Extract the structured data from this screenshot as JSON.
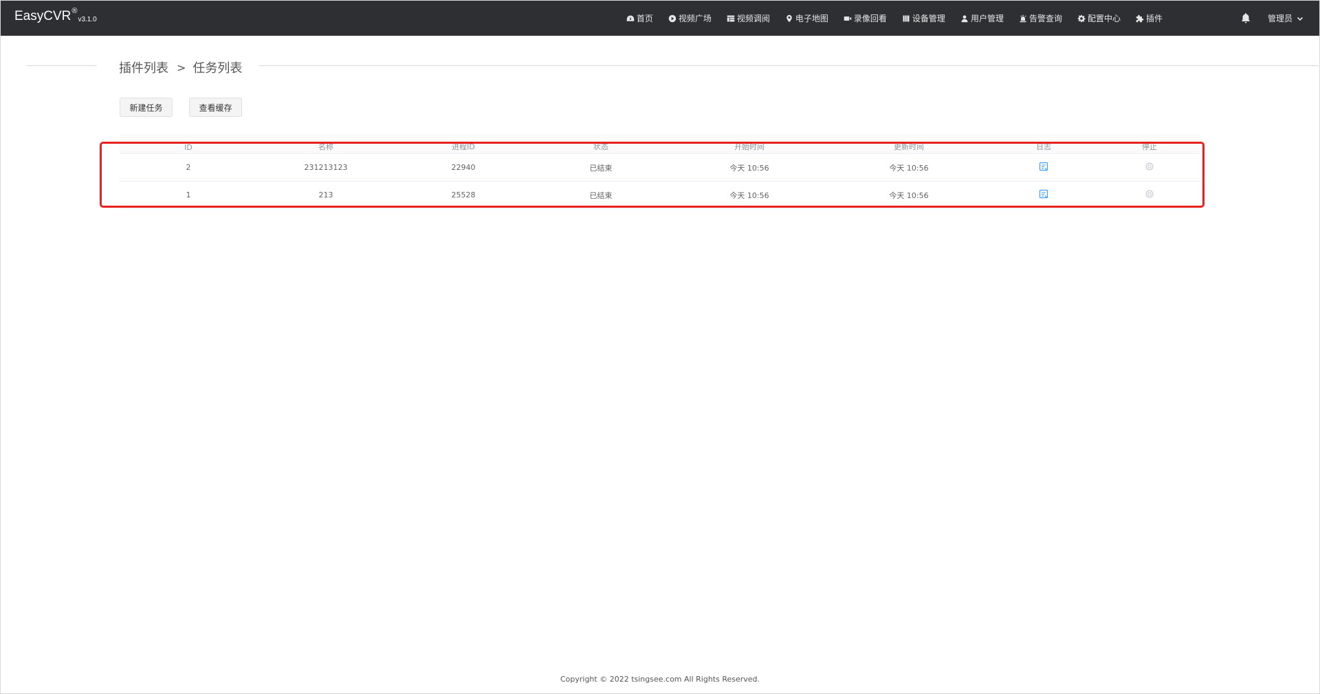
{
  "app": {
    "brand": "EasyCVR",
    "brand_mark": "®",
    "version": "v3.1.0"
  },
  "nav": {
    "items": [
      {
        "label": "首页",
        "icon": "dashboard-icon"
      },
      {
        "label": "视频广场",
        "icon": "play-circle-icon"
      },
      {
        "label": "视频调阅",
        "icon": "grid-icon"
      },
      {
        "label": "电子地图",
        "icon": "map-pin-icon"
      },
      {
        "label": "录像回看",
        "icon": "video-camera-icon"
      },
      {
        "label": "设备管理",
        "icon": "device-icon"
      },
      {
        "label": "用户管理",
        "icon": "user-icon"
      },
      {
        "label": "告警查询",
        "icon": "alarm-icon"
      },
      {
        "label": "配置中心",
        "icon": "gear-icon"
      },
      {
        "label": "插件",
        "icon": "puzzle-icon"
      }
    ],
    "user": "管理员"
  },
  "breadcrumb": {
    "parent": "插件列表",
    "separator": ">",
    "current": "任务列表"
  },
  "toolbar": {
    "new_task": "新建任务",
    "view_cache": "查看缓存"
  },
  "table": {
    "columns": [
      "ID",
      "名称",
      "进程ID",
      "状态",
      "开始时间",
      "更新时间",
      "日志",
      "停止"
    ],
    "rows": [
      {
        "id": "2",
        "name": "231213123",
        "pid": "22940",
        "status": "已结束",
        "start": "今天 10:56",
        "update": "今天 10:56"
      },
      {
        "id": "1",
        "name": "213",
        "pid": "25528",
        "status": "已结束",
        "start": "今天 10:56",
        "update": "今天 10:56"
      }
    ]
  },
  "footer": {
    "copyright": "Copyright © 2022 tsingsee.com All Rights Reserved."
  },
  "colors": {
    "navbar_bg": "#2d2f33",
    "highlight": "#e8201f",
    "log_icon": "#409eff"
  }
}
